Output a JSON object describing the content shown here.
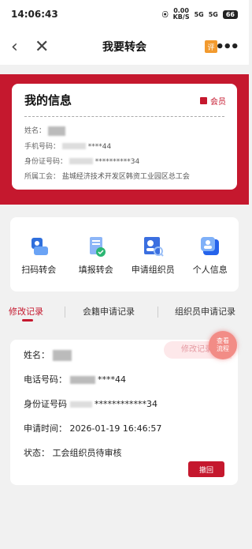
{
  "status_bar": {
    "time": "14:06:43",
    "net_speed": "0.00",
    "net_unit": "KB/S",
    "signal1": "5G",
    "signal2": "5G",
    "battery": "66"
  },
  "nav": {
    "title": "我要转会",
    "rate_icon": "评"
  },
  "info": {
    "title": "我的信息",
    "member_label": "会员",
    "name_label": "姓名：",
    "phone_label": "手机号码：",
    "phone_value": "****44",
    "id_label": "身份证号码：",
    "id_value": "**********34",
    "union_label": "所属工会：",
    "union_value": "盐城经济技术开发区韩资工业园区总工会"
  },
  "functions": [
    {
      "label": "扫码转会",
      "icon": "scan-transfer-icon",
      "color": "#2f6fdc"
    },
    {
      "label": "填报转会",
      "icon": "form-transfer-icon",
      "color": "#3b82f6"
    },
    {
      "label": "申请组织员",
      "icon": "apply-organizer-icon",
      "color": "#3b6fe0"
    },
    {
      "label": "个人信息",
      "icon": "personal-info-icon",
      "color": "#2563eb"
    }
  ],
  "tabs": [
    {
      "label": "修改记录",
      "active": true
    },
    {
      "label": "会籍申请记录",
      "active": false
    },
    {
      "label": "组织员申请记录",
      "active": false
    }
  ],
  "record": {
    "name_label": "姓名：",
    "phone_label": "电话号码：",
    "phone_value": "****44",
    "id_label": "身份证号码",
    "id_value": "************34",
    "time_label": "申请时间：",
    "time_value": "2026-01-19 16:46:57",
    "status_label": "状态：",
    "status_value": "工会组织员待审核",
    "badge": "修改记录",
    "fab_line1": "查看",
    "fab_line2": "流程",
    "withdraw": "撤回"
  },
  "colors": {
    "primary": "#c5182e",
    "background": "#f1f1f1"
  }
}
